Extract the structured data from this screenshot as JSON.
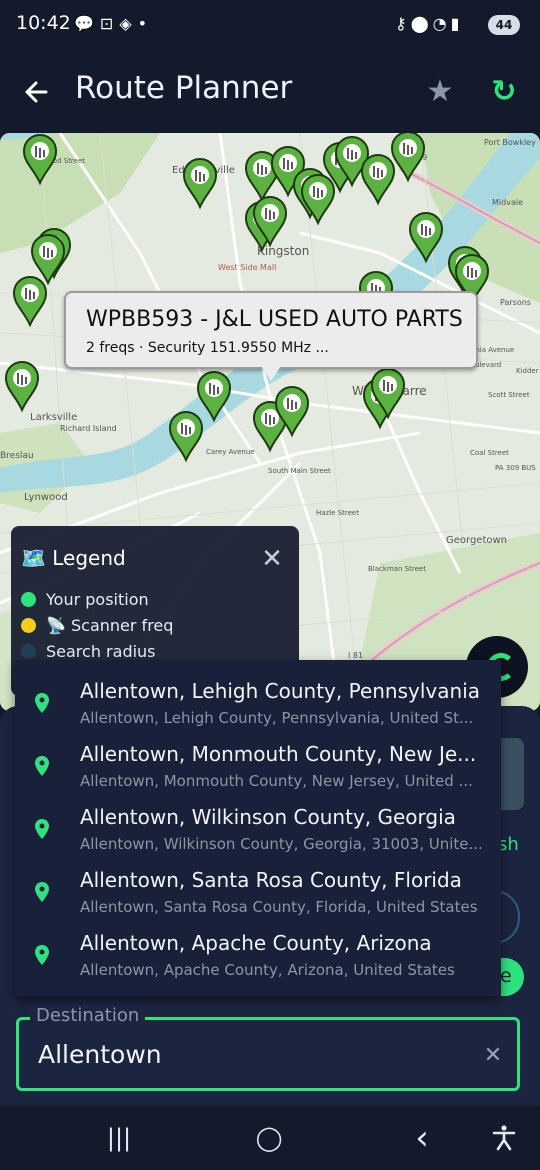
{
  "status_bar": {
    "time": "10:42",
    "left_icons": [
      "chat-bubble-icon",
      "screen-record-icon",
      "ar-cube-icon",
      "dot-icon"
    ],
    "right_icons": [
      "key-icon",
      "location-icon",
      "wifi-6e-icon",
      "signal-icon"
    ],
    "battery": "44"
  },
  "app_bar": {
    "title": "Route Planner",
    "back_icon": "←",
    "star_icon": "★",
    "refresh_icon": "↻"
  },
  "map": {
    "marker_color": "#5bb240",
    "callout": {
      "title": "WPBB593 - J&L USED AUTO PARTS",
      "subtitle": "2 freqs · Security 151.9550 MHz ..."
    },
    "labels": [
      "Edwardsville",
      "Kingston",
      "West Side Mall",
      "Wilkes-Barre",
      "Larksville",
      "Richard Island",
      "Lynwood",
      "Breslau",
      "Georgetown",
      "PA 309 BUS",
      "Port Bowkley",
      "Midvale",
      "Parsons",
      "Coal Street",
      "Kidder Street",
      "Scott Street",
      "Wilkes-Barre Boulevard",
      "Pennsylvania Avenue",
      "Carey Avenue",
      "Hazle Street",
      "Blackman Street",
      "South Main Street",
      "Wood Street",
      "309",
      "I 81"
    ]
  },
  "legend": {
    "title": "Legend",
    "map_icon": "🗺️",
    "close": "✕",
    "items": [
      {
        "label": "Your position",
        "color": "#2ee37f"
      },
      {
        "label": "📡 Scanner freq",
        "color": "#f5cc1b"
      },
      {
        "label": "Search radius",
        "color": "#22405a"
      }
    ]
  },
  "suggestions": [
    {
      "main": "Allentown, Lehigh County, Pennsylvania",
      "sub": "Allentown, Lehigh County, Pennsylvania, United St..."
    },
    {
      "main": "Allentown, Monmouth County, New Je...",
      "sub": "Allentown, Monmouth County, New Jersey, United ..."
    },
    {
      "main": "Allentown, Wilkinson County, Georgia",
      "sub": "Allentown, Wilkinson County, Georgia, 31003, Unite..."
    },
    {
      "main": "Allentown, Santa Rosa County, Florida",
      "sub": "Allentown, Santa Rosa County, Florida, United States"
    },
    {
      "main": "Allentown, Apache County, Arizona",
      "sub": "Allentown, Apache County, Arizona, United States"
    }
  ],
  "sheet": {
    "partial_text": "sh",
    "pill_text": "e"
  },
  "destination": {
    "label": "Destination",
    "value": "Allentown",
    "clear_icon": "✕"
  },
  "nav_bar": {
    "recents": "|||",
    "home": "◯",
    "back": "‹",
    "accessibility": "accessibility-icon"
  },
  "colors": {
    "accent": "#2ee37f",
    "background": "#121a2c",
    "sheet": "#1c2540",
    "dropdown": "#18203a"
  }
}
